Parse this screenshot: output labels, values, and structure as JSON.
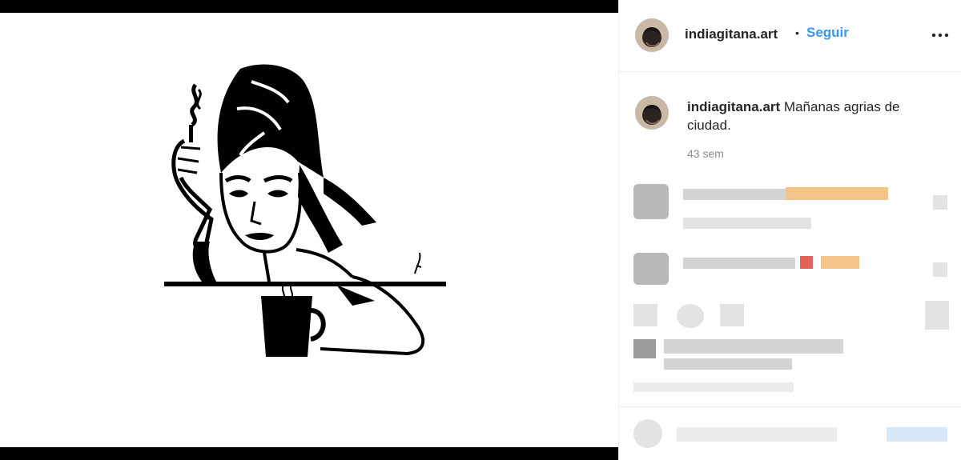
{
  "post": {
    "username": "indiagitana.art",
    "separator": "•",
    "follow_label": "Seguir",
    "more_icon": "more-horizontal-icon"
  },
  "caption": {
    "username": "indiagitana.art",
    "text": "Mañanas agrias de ciudad.",
    "time": "43 sem"
  },
  "colors": {
    "link": "#3897f0",
    "text": "#262626",
    "muted": "#8e8e8e"
  }
}
